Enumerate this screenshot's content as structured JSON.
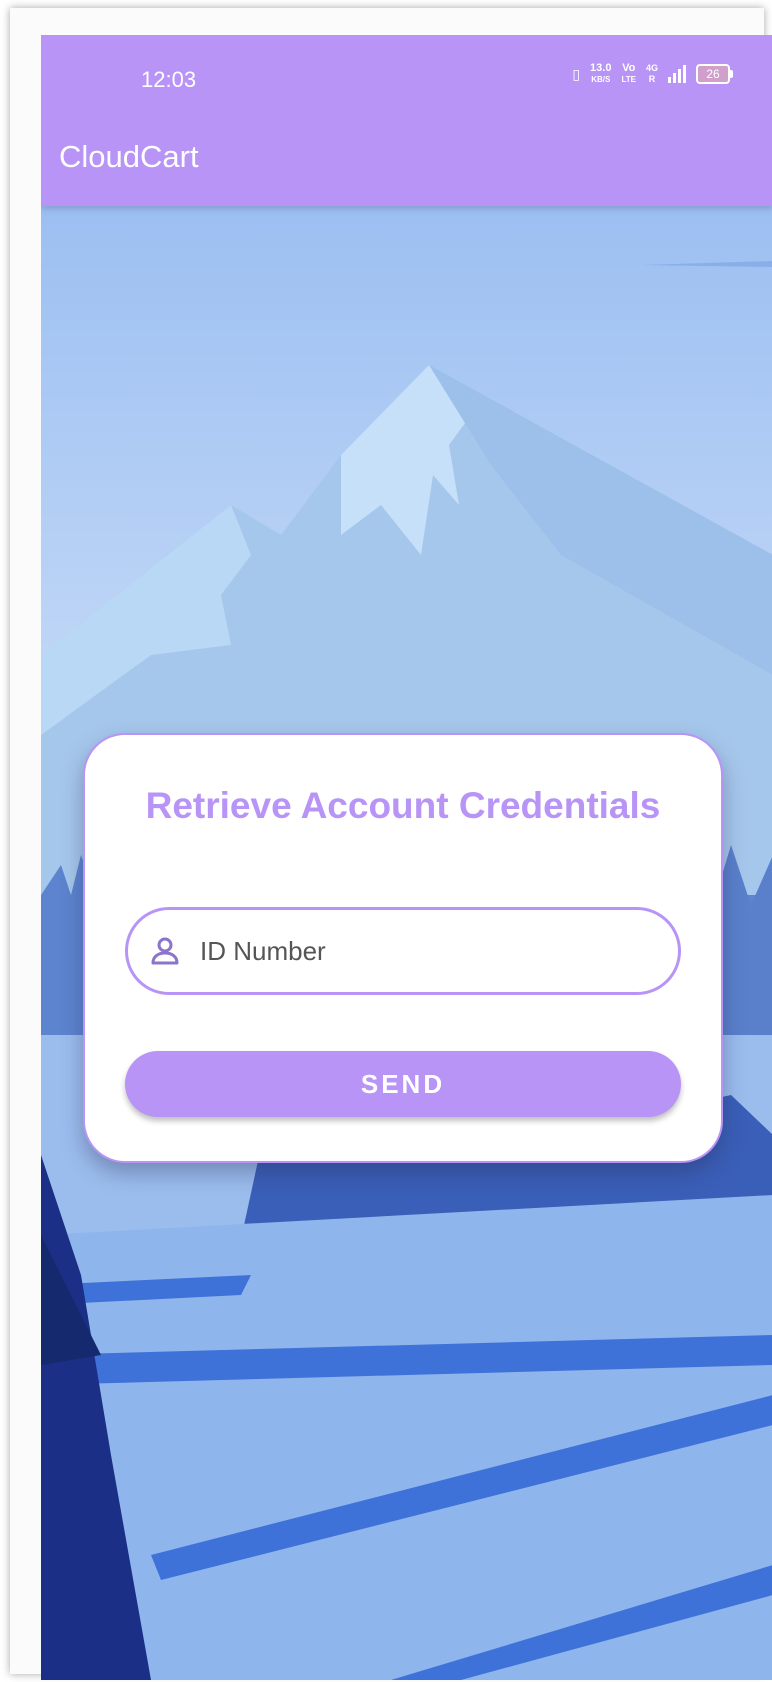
{
  "status_bar": {
    "time": "12:03",
    "net_speed_value": "13.0",
    "net_speed_unit": "KB/S",
    "volte_top": "Vo",
    "volte_bottom": "LTE",
    "network_top": "4G",
    "network_bottom": "R",
    "battery": "26"
  },
  "app_bar": {
    "title": "CloudCart"
  },
  "card": {
    "title": "Retrieve Account Credentials",
    "id_field": {
      "placeholder": "ID Number",
      "value": ""
    },
    "send_label": "SEND"
  },
  "colors": {
    "accent": "#b794f6",
    "sky_top": "#8fb7f0",
    "mountain": "#a8c8ee",
    "forest_dark": "#2c4da0",
    "snow_field": "#8fb6ec"
  },
  "icons": {
    "field_icon": "person-icon"
  }
}
